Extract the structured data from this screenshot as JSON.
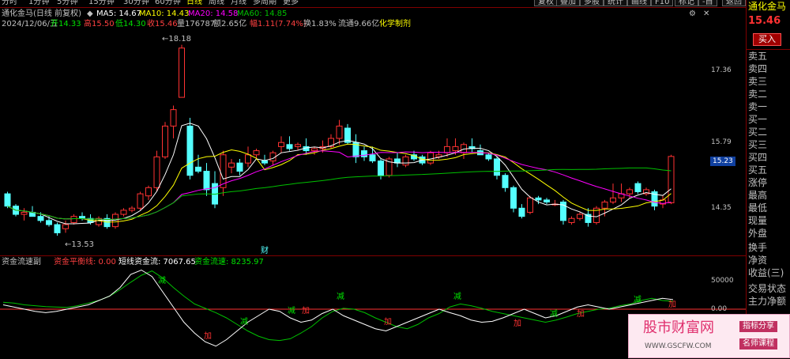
{
  "toolbar": {
    "periods": [
      "分时",
      "1分钟",
      "5分钟",
      "15分钟",
      "30分钟",
      "60分钟",
      "日线",
      "周线",
      "月线",
      "多周期",
      "更多"
    ],
    "active_period": "日线",
    "right_buttons": [
      "复权",
      "叠加",
      "多股",
      "统计",
      "画线",
      "F10",
      "标记",
      "-自",
      "返回"
    ]
  },
  "stock": {
    "title": "通化金马(日线 前复权)",
    "name": "通化金马",
    "price": "15.46",
    "buy_button": "买入"
  },
  "ma": {
    "ma5": "MA5: 14.67",
    "ma10": "MA10: 14.43",
    "ma20": "MA20: 14.58",
    "ma60": "MA60: 14.85"
  },
  "quote": {
    "date": "2024/12/06/五",
    "open": "开14.33",
    "high": "高15.50",
    "low": "低14.30",
    "close": "收15.46",
    "volume": "量176787",
    "amount": "额2.65亿",
    "change": "幅1.11(7.74%)",
    "turnover": "换1.83%",
    "float": "流通9.66亿",
    "sector": "化学制剂"
  },
  "annotations": {
    "high_label": "18.18",
    "low_label": "13.53",
    "finance_marker": "财",
    "current_price_tag": "15.23"
  },
  "price_axis": [
    "17.36",
    "15.79",
    "14.35"
  ],
  "right_panel": {
    "items": [
      "卖五",
      "卖四",
      "卖三",
      "卖二",
      "卖一",
      "买一",
      "买二",
      "买三",
      "买四",
      "买五",
      "涨停",
      "最高",
      "最低",
      "现量",
      "外盘",
      "换手",
      "净资",
      "收益(三)",
      "交易状态",
      "主力净额"
    ]
  },
  "indicator": {
    "name": "资金流速副",
    "balance": "资金平衡线: 0.00",
    "short_flow": "短线资金流: 7067.65",
    "flow_speed": "资金流速: 8235.97",
    "axis": [
      "50000",
      "0.00"
    ],
    "add_label": "加",
    "reduce_label": "减"
  },
  "watermark": {
    "title": "股市财富网",
    "url": "WWW.GSCFW.COM",
    "btn1": "指标分享",
    "btn2": "名师课程"
  },
  "colors": {
    "up": "#ff3232",
    "down": "#54ffff",
    "ma5": "#ffffff",
    "ma10": "#ffff00",
    "ma20": "#ff00ff",
    "ma60": "#00c000",
    "border": "#800000"
  },
  "chart_data": {
    "type": "candlestick",
    "y_range": [
      13.3,
      18.5
    ],
    "candles": [
      {
        "o": 14.55,
        "h": 14.6,
        "l": 14.2,
        "c": 14.25
      },
      {
        "o": 14.25,
        "h": 14.3,
        "l": 14.0,
        "c": 14.05
      },
      {
        "o": 14.05,
        "h": 14.2,
        "l": 13.9,
        "c": 14.1
      },
      {
        "o": 14.1,
        "h": 14.25,
        "l": 14.0,
        "c": 14.0
      },
      {
        "o": 14.0,
        "h": 14.1,
        "l": 13.85,
        "c": 13.9
      },
      {
        "o": 13.9,
        "h": 14.0,
        "l": 13.75,
        "c": 13.8
      },
      {
        "o": 13.8,
        "h": 13.85,
        "l": 13.53,
        "c": 13.6
      },
      {
        "o": 13.7,
        "h": 13.9,
        "l": 13.6,
        "c": 13.8
      },
      {
        "o": 13.85,
        "h": 14.05,
        "l": 13.8,
        "c": 14.0
      },
      {
        "o": 14.0,
        "h": 14.1,
        "l": 13.9,
        "c": 13.95
      },
      {
        "o": 13.95,
        "h": 14.05,
        "l": 13.8,
        "c": 13.85
      },
      {
        "o": 13.8,
        "h": 14.0,
        "l": 13.75,
        "c": 13.95
      },
      {
        "o": 13.95,
        "h": 14.05,
        "l": 13.7,
        "c": 13.75
      },
      {
        "o": 13.75,
        "h": 14.1,
        "l": 13.7,
        "c": 14.05
      },
      {
        "o": 14.05,
        "h": 14.2,
        "l": 14.0,
        "c": 14.15
      },
      {
        "o": 14.15,
        "h": 14.25,
        "l": 14.1,
        "c": 14.2
      },
      {
        "o": 14.2,
        "h": 14.6,
        "l": 14.15,
        "c": 14.55
      },
      {
        "o": 14.5,
        "h": 14.75,
        "l": 14.4,
        "c": 14.7
      },
      {
        "o": 14.7,
        "h": 15.6,
        "l": 14.6,
        "c": 15.45
      },
      {
        "o": 15.45,
        "h": 16.3,
        "l": 15.4,
        "c": 16.2
      },
      {
        "o": 16.2,
        "h": 16.7,
        "l": 15.9,
        "c": 16.6
      },
      {
        "o": 16.9,
        "h": 18.18,
        "l": 16.9,
        "c": 18.1
      },
      {
        "o": 16.2,
        "h": 16.4,
        "l": 14.9,
        "c": 15.0
      },
      {
        "o": 15.2,
        "h": 15.5,
        "l": 15.05,
        "c": 15.1
      },
      {
        "o": 15.1,
        "h": 15.3,
        "l": 14.5,
        "c": 14.65
      },
      {
        "o": 14.8,
        "h": 15.1,
        "l": 14.2,
        "c": 14.3
      },
      {
        "o": 14.7,
        "h": 15.6,
        "l": 14.5,
        "c": 15.5
      },
      {
        "o": 15.2,
        "h": 15.4,
        "l": 15.05,
        "c": 15.3
      },
      {
        "o": 15.3,
        "h": 15.4,
        "l": 15.0,
        "c": 15.1
      },
      {
        "o": 15.3,
        "h": 15.7,
        "l": 15.2,
        "c": 15.5
      },
      {
        "o": 15.5,
        "h": 15.65,
        "l": 15.4,
        "c": 15.6
      },
      {
        "o": 15.35,
        "h": 15.5,
        "l": 15.25,
        "c": 15.3
      },
      {
        "o": 15.35,
        "h": 15.6,
        "l": 15.25,
        "c": 15.55
      },
      {
        "o": 15.7,
        "h": 15.95,
        "l": 15.55,
        "c": 15.8
      },
      {
        "o": 15.75,
        "h": 15.95,
        "l": 15.6,
        "c": 15.65
      },
      {
        "o": 15.7,
        "h": 15.8,
        "l": 15.6,
        "c": 15.75
      },
      {
        "o": 15.7,
        "h": 15.9,
        "l": 15.5,
        "c": 15.6
      },
      {
        "o": 15.6,
        "h": 15.7,
        "l": 15.5,
        "c": 15.65
      },
      {
        "o": 15.65,
        "h": 15.85,
        "l": 15.55,
        "c": 15.7
      },
      {
        "o": 15.7,
        "h": 16.0,
        "l": 15.65,
        "c": 15.9
      },
      {
        "o": 15.9,
        "h": 16.35,
        "l": 15.75,
        "c": 16.2
      },
      {
        "o": 16.15,
        "h": 16.25,
        "l": 15.75,
        "c": 15.8
      },
      {
        "o": 15.8,
        "h": 16.0,
        "l": 15.3,
        "c": 15.45
      },
      {
        "o": 15.6,
        "h": 15.7,
        "l": 15.35,
        "c": 15.45
      },
      {
        "o": 15.5,
        "h": 15.7,
        "l": 15.3,
        "c": 15.35
      },
      {
        "o": 15.35,
        "h": 15.4,
        "l": 14.9,
        "c": 15.0
      },
      {
        "o": 15.0,
        "h": 15.45,
        "l": 14.95,
        "c": 15.4
      },
      {
        "o": 15.4,
        "h": 15.55,
        "l": 15.2,
        "c": 15.3
      },
      {
        "o": 15.25,
        "h": 15.5,
        "l": 15.2,
        "c": 15.45
      },
      {
        "o": 15.5,
        "h": 15.6,
        "l": 15.35,
        "c": 15.4
      },
      {
        "o": 15.45,
        "h": 15.5,
        "l": 15.25,
        "c": 15.3
      },
      {
        "o": 15.3,
        "h": 15.6,
        "l": 15.25,
        "c": 15.55
      },
      {
        "o": 15.45,
        "h": 15.6,
        "l": 15.4,
        "c": 15.5
      },
      {
        "o": 15.55,
        "h": 15.9,
        "l": 15.45,
        "c": 15.7
      },
      {
        "o": 15.6,
        "h": 15.9,
        "l": 15.5,
        "c": 15.7
      },
      {
        "o": 15.55,
        "h": 15.8,
        "l": 15.4,
        "c": 15.75
      },
      {
        "o": 15.7,
        "h": 15.9,
        "l": 15.55,
        "c": 15.65
      },
      {
        "o": 15.6,
        "h": 15.75,
        "l": 15.5,
        "c": 15.5
      },
      {
        "o": 15.5,
        "h": 15.55,
        "l": 15.35,
        "c": 15.4
      },
      {
        "o": 15.4,
        "h": 15.45,
        "l": 14.9,
        "c": 15.0
      },
      {
        "o": 15.0,
        "h": 15.05,
        "l": 14.6,
        "c": 14.7
      },
      {
        "o": 14.7,
        "h": 14.75,
        "l": 14.1,
        "c": 14.2
      },
      {
        "o": 14.2,
        "h": 14.3,
        "l": 13.95,
        "c": 14.0
      },
      {
        "o": 14.1,
        "h": 14.5,
        "l": 14.05,
        "c": 14.45
      },
      {
        "o": 14.45,
        "h": 14.5,
        "l": 14.3,
        "c": 14.4
      },
      {
        "o": 14.4,
        "h": 14.45,
        "l": 14.3,
        "c": 14.35
      },
      {
        "o": 14.3,
        "h": 14.4,
        "l": 14.25,
        "c": 14.3
      },
      {
        "o": 14.35,
        "h": 14.4,
        "l": 13.8,
        "c": 13.9
      },
      {
        "o": 13.85,
        "h": 14.0,
        "l": 13.8,
        "c": 13.95
      },
      {
        "o": 13.95,
        "h": 14.1,
        "l": 13.9,
        "c": 14.05
      },
      {
        "o": 14.05,
        "h": 14.2,
        "l": 13.75,
        "c": 13.85
      },
      {
        "o": 13.85,
        "h": 14.25,
        "l": 13.8,
        "c": 14.2
      },
      {
        "o": 14.2,
        "h": 14.4,
        "l": 14.0,
        "c": 14.35
      },
      {
        "o": 14.35,
        "h": 14.8,
        "l": 14.3,
        "c": 14.45
      },
      {
        "o": 14.45,
        "h": 14.8,
        "l": 14.35,
        "c": 14.55
      },
      {
        "o": 14.55,
        "h": 14.7,
        "l": 14.45,
        "c": 14.65
      },
      {
        "o": 14.8,
        "h": 14.85,
        "l": 14.55,
        "c": 14.6
      },
      {
        "o": 14.55,
        "h": 14.7,
        "l": 14.5,
        "c": 14.65
      },
      {
        "o": 14.6,
        "h": 14.65,
        "l": 14.15,
        "c": 14.25
      },
      {
        "o": 14.3,
        "h": 14.5,
        "l": 14.2,
        "c": 14.4
      },
      {
        "o": 14.33,
        "h": 15.5,
        "l": 14.3,
        "c": 15.46
      }
    ],
    "flow_speed": [
      0.16,
      0.14,
      0.1,
      0.08,
      0.06,
      0.05,
      0.04,
      0.08,
      0.14,
      0.2,
      0.3,
      0.45,
      0.62,
      0.78,
      0.88,
      0.72,
      0.5,
      0.3,
      0.12,
      0.02,
      -0.08,
      -0.2,
      -0.35,
      -0.5,
      -0.62,
      -0.7,
      -0.72,
      -0.68,
      -0.55,
      -0.4,
      -0.2,
      -0.05,
      0.02,
      0.0,
      -0.08,
      -0.2,
      -0.3,
      -0.4,
      -0.45,
      -0.35,
      -0.2,
      -0.1,
      0.05,
      0.12,
      0.08,
      0.02,
      -0.05,
      -0.1,
      -0.15,
      -0.2,
      -0.25,
      -0.3,
      -0.25,
      -0.18,
      -0.1,
      -0.05,
      0.0,
      0.02,
      0.08,
      0.12,
      0.2,
      0.25,
      0.2,
      0.18
    ],
    "short_flow": [
      0.1,
      0.05,
      0.0,
      -0.05,
      -0.08,
      -0.05,
      0.0,
      0.05,
      0.1,
      0.2,
      0.3,
      0.5,
      0.8,
      0.9,
      0.75,
      0.4,
      0.05,
      -0.3,
      -0.55,
      -0.75,
      -0.85,
      -0.7,
      -0.5,
      -0.3,
      -0.15,
      0.0,
      -0.05,
      -0.2,
      -0.3,
      -0.25,
      -0.1,
      0.0,
      -0.15,
      -0.25,
      -0.35,
      -0.45,
      -0.5,
      -0.4,
      -0.3,
      -0.2,
      -0.1,
      0.0,
      -0.08,
      -0.15,
      -0.25,
      -0.3,
      -0.28,
      -0.2,
      -0.1,
      0.0,
      -0.1,
      -0.2,
      -0.15,
      -0.05,
      0.05,
      0.1,
      0.05,
      0.0,
      0.05,
      0.1,
      0.15,
      0.2,
      0.25,
      0.22
    ]
  }
}
